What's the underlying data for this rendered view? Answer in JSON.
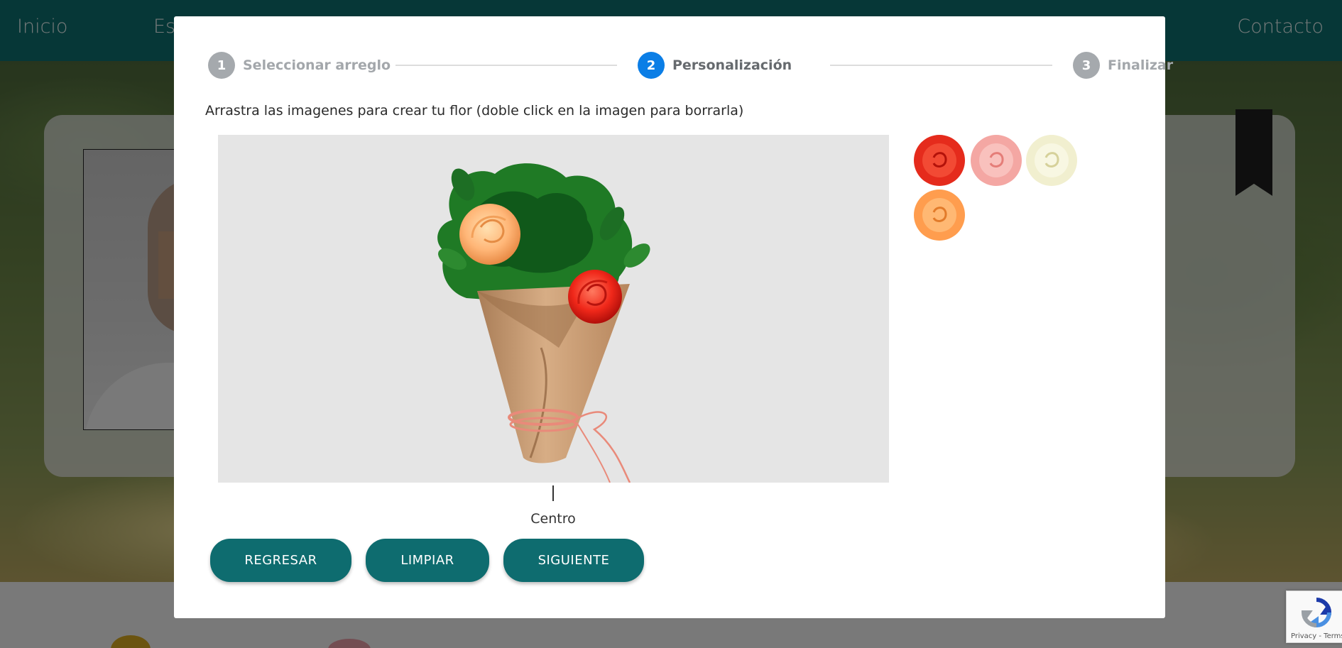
{
  "nav": {
    "inicio": "Inicio",
    "partial": "Es",
    "contacto": "Contacto"
  },
  "stepper": {
    "steps": [
      {
        "number": "1",
        "label": "Seleccionar arreglo",
        "state": "inactive"
      },
      {
        "number": "2",
        "label": "Personalización",
        "state": "active"
      },
      {
        "number": "3",
        "label": "Finalizar",
        "state": "inactive"
      }
    ]
  },
  "modal": {
    "instructions": "Arrastra las imagenes para crear tu flor (doble click en la imagen para borrarla)",
    "center_label": "Centro"
  },
  "palette": {
    "items": [
      "red-rose",
      "pink-rose",
      "white-rose",
      "orange-rose"
    ]
  },
  "buttons": {
    "regresar": "REGRESAR",
    "limpiar": "LIMPIAR",
    "siguiente": "SIGUIENTE"
  },
  "recaptcha": {
    "terms": "Privacy - Terms"
  },
  "colors": {
    "navbar": "#0d6e6e",
    "button": "#0e6c6f",
    "active_step": "#0b7ee6",
    "inactive_step": "#a5a9ad"
  }
}
